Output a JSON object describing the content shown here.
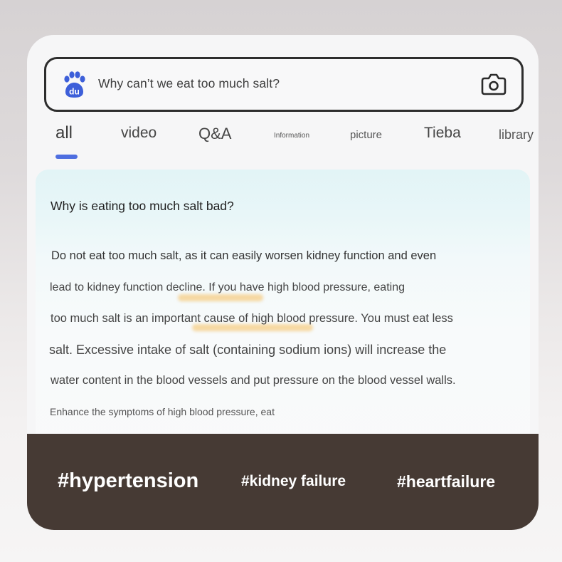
{
  "search": {
    "query": "Why can’t we eat too much salt?"
  },
  "tabs": [
    {
      "label": "all",
      "active": true
    },
    {
      "label": "video"
    },
    {
      "label": "Q&A"
    },
    {
      "label": "Information"
    },
    {
      "label": "picture"
    },
    {
      "label": "Tieba"
    },
    {
      "label": "library"
    }
  ],
  "answer": {
    "title": "Why is eating too much salt bad?",
    "lines": [
      "Do not eat too much salt, as it can easily worsen kidney function and even",
      "lead to kidney function decline. If you have high blood pressure, eating",
      "too much salt is an important cause of high blood pressure. You must eat less",
      "salt. Excessive intake of salt (containing sodium ions) will increase the",
      "water content in the blood vessels and put pressure on the blood vessel walls.",
      "Enhance the symptoms of high blood pressure, eat"
    ]
  },
  "tags": [
    "#hypertension",
    "#kidney failure",
    "#heartfailure"
  ],
  "colors": {
    "accent": "#4e6ee0",
    "tag_bar": "#463a34",
    "highlight": "#f5be5a"
  },
  "icons": {
    "logo": "baidu-paw-icon",
    "camera": "camera-icon"
  }
}
